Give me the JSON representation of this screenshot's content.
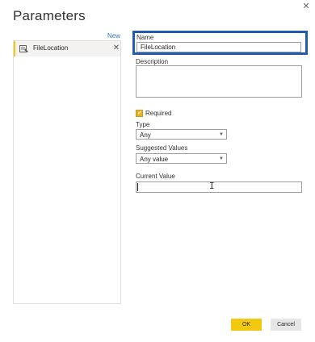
{
  "dialog": {
    "title": "Parameters",
    "close_glyph": "✕"
  },
  "param_list": {
    "new_label": "New",
    "items": [
      {
        "label": "FileLocation",
        "icon": "parameter-icon",
        "remove_glyph": "✕"
      }
    ]
  },
  "form": {
    "name_label": "Name",
    "name_value": "FileLocation",
    "description_label": "Description",
    "description_value": "",
    "required_label": "Required",
    "required_checked": true,
    "type_label": "Type",
    "type_value": "Any",
    "suggested_label": "Suggested Values",
    "suggested_value": "Any value",
    "current_label": "Current Value",
    "current_value": ""
  },
  "buttons": {
    "ok": "OK",
    "cancel": "Cancel"
  },
  "colors": {
    "accent": "#f2c811",
    "highlight_box": "#1f5ab3",
    "link": "#2b7bd1"
  }
}
